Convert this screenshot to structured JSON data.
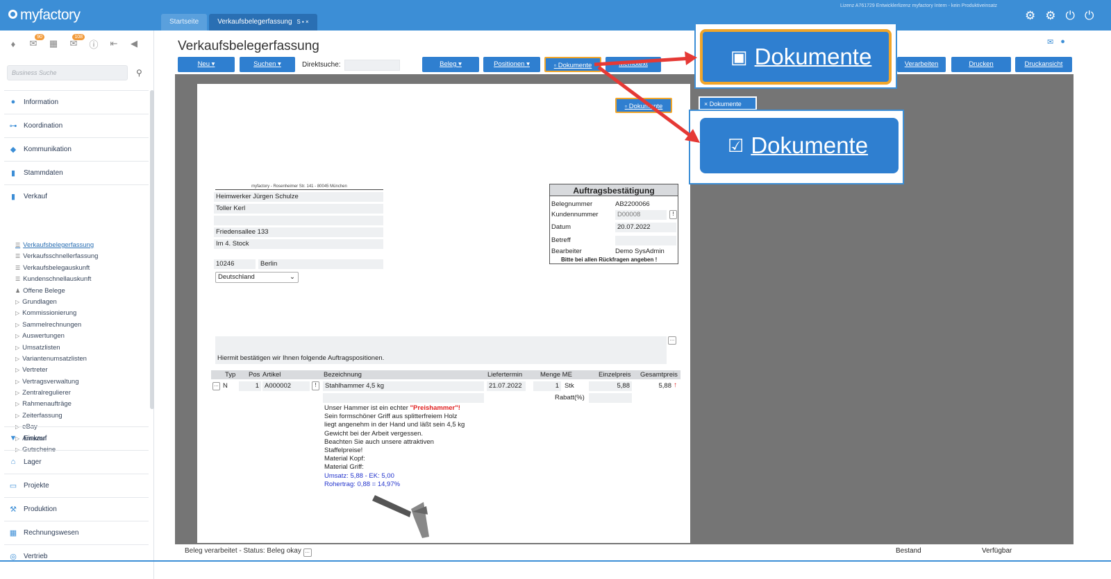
{
  "app": {
    "logo": "myfactory",
    "license": "Lizenz A761729 Entwicklerlizenz myfactory Intern - kein Produktiveinsatz"
  },
  "tabs": [
    {
      "label": "Startseite"
    },
    {
      "label": "Verkaufsbelegerfassung"
    }
  ],
  "active_tab_controls": "S ▪ ×",
  "sidebar": {
    "badges": {
      "b1": "90",
      "b2": "108"
    },
    "search_placeholder": "Business Suche",
    "sections_top": [
      "Information",
      "Koordination",
      "Kommunikation",
      "Stammdaten",
      "Verkauf"
    ],
    "verkauf_items": [
      {
        "label": "Verkaufsbelegerfassung",
        "marker": "☰"
      },
      {
        "label": "Verkaufsschnellerfassung",
        "marker": "☰"
      },
      {
        "label": "Verkaufsbelegauskunft",
        "marker": "☰"
      },
      {
        "label": "Kundenschnellauskunft",
        "marker": "☰"
      },
      {
        "label": "Offene Belege",
        "marker": "♟"
      },
      {
        "label": "Grundlagen",
        "marker": "▷"
      },
      {
        "label": "Kommissionierung",
        "marker": "▷"
      },
      {
        "label": "Sammelrechnungen",
        "marker": "▷"
      },
      {
        "label": "Auswertungen",
        "marker": "▷"
      },
      {
        "label": "Umsatzlisten",
        "marker": "▷"
      },
      {
        "label": "Variantenumsatzlisten",
        "marker": "▷"
      },
      {
        "label": "Vertreter",
        "marker": "▷"
      },
      {
        "label": "Vertragsverwaltung",
        "marker": "▷"
      },
      {
        "label": "Zentralregulierer",
        "marker": "▷"
      },
      {
        "label": "Rahmenaufträge",
        "marker": "▷"
      },
      {
        "label": "Zeiterfassung",
        "marker": "▷"
      },
      {
        "label": "eBay",
        "marker": "▷"
      },
      {
        "label": "Amazon",
        "marker": "▷"
      },
      {
        "label": "Gutscheine",
        "marker": "▷"
      }
    ],
    "sections_bottom": [
      "Einkauf",
      "Lager",
      "Projekte",
      "Produktion",
      "Rechnungswesen",
      "Vertrieb"
    ]
  },
  "page": {
    "title": "Verkaufsbelegerfassung"
  },
  "toolbar": {
    "neu": "Neu",
    "suchen": "Suchen",
    "direkt_label": "Direktsuche:",
    "beleg": "Beleg",
    "positionen": "Positionen",
    "dokumente": "Dokumente",
    "memotext": "Memotext",
    "verarbeiten": "Verarbeiten",
    "drucken": "Drucken",
    "druckansicht": "Druckansicht"
  },
  "doc": {
    "dok_btn": "Dokumente",
    "sender": "myfactory - Rosenheimer Str. 141 - 80045 München",
    "address": [
      "Heimwerker Jürgen Schulze",
      "Toller Kerl",
      "",
      "Friedensallee 133",
      "Im 4. Stock"
    ],
    "plz": "10246",
    "city": "Berlin",
    "country": "Deutschland",
    "box_title": "Auftragsbestätigung",
    "box_rows": [
      {
        "label": "Belegnummer",
        "value": "AB2200066"
      },
      {
        "label": "Kundennummer",
        "value": "D00008"
      },
      {
        "label": "Datum",
        "value": "20.07.2022"
      },
      {
        "label": "Betreff",
        "value": ""
      },
      {
        "label": "Bearbeiter",
        "value": "Demo SysAdmin"
      }
    ],
    "box_note": "Bitte bei allen Rückfragen angeben !",
    "intro": "Hiermit bestätigen wir Ihnen folgende Auftragspositionen.",
    "headers": {
      "typ": "Typ",
      "pos": "Pos",
      "artikel": "Artikel",
      "bez": "Bezeichnung",
      "liefer": "Liefertermin",
      "menge": "Menge ME",
      "ep": "Einzelpreis",
      "gp": "Gesamtpreis"
    },
    "row": {
      "typ": "N",
      "pos": "1",
      "artikel": "A000002",
      "bez": "Stahlhammer 4,5 kg",
      "liefer": "21.07.2022",
      "menge": "1",
      "me": "Stk",
      "ep": "5,88",
      "gp": "5,88"
    },
    "rabatt_label": "Rabatt(%)",
    "desc_pre": "Unser Hammer ist ein echter ",
    "desc_hl": "\"Preishammer\"!",
    "desc_rest": "Sein formschöner Griff aus splitterfreiem Holz\nliegt angenehm in der Hand und läßt sein 4,5 kg\nGewicht bei der Arbeit vergessen.\nBeachten Sie auch unsere attraktiven\nStaffelpreise!\nMaterial Kopf:\nMaterial Griff:",
    "umsatz": "Umsatz: 5,88 - EK: 5,00",
    "rohertrag": "Rohertrag: 0,88 = 14,97%"
  },
  "rightpanel": {
    "dok_tab": "Dokumente"
  },
  "callouts": {
    "top": "Dokumente",
    "bottom": "Dokumente"
  },
  "status": {
    "text": "Beleg verarbeitet - Status: Beleg okay",
    "bestand": "Bestand",
    "verfuegbar": "Verfügbar"
  }
}
